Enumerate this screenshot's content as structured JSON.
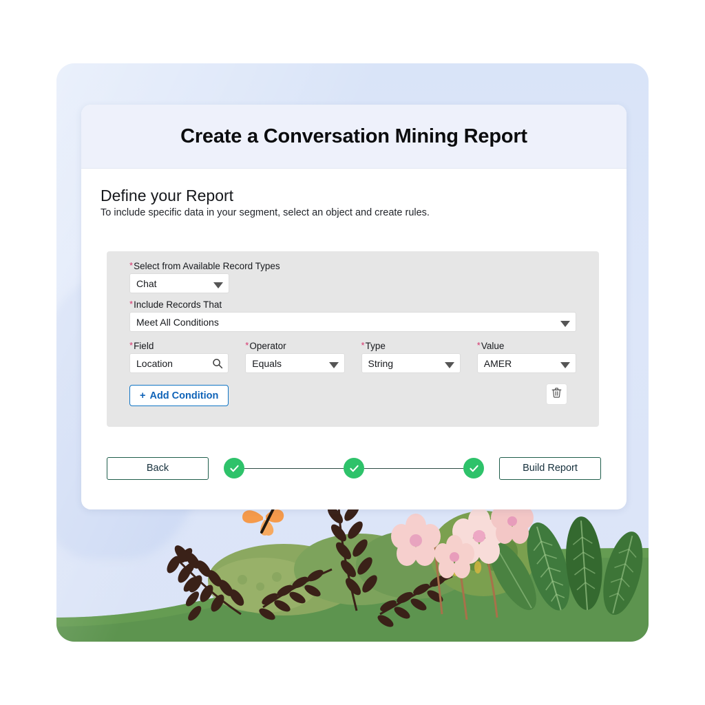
{
  "window": {
    "card_title": "Create a Conversation Mining Report",
    "section_heading": "Define your Report",
    "section_subtitle": "To include specific data in your segment, select an object and create rules."
  },
  "form": {
    "required_marker": "*",
    "record_types": {
      "label": "Select from Available Record Types",
      "value": "Chat",
      "icon": "chevron-down-icon"
    },
    "include_records": {
      "label": "Include Records That",
      "value": "Meet All Conditions",
      "icon": "chevron-down-icon"
    },
    "conditions": [
      {
        "field": {
          "label": "Field",
          "value": "Location",
          "icon": "search-icon"
        },
        "operator": {
          "label": "Operator",
          "value": "Equals",
          "icon": "chevron-down-icon"
        },
        "type": {
          "label": "Type",
          "value": "String",
          "icon": "chevron-down-icon"
        },
        "value": {
          "label": "Value",
          "value": "AMER",
          "icon": "chevron-down-icon"
        }
      }
    ],
    "add_condition_label": "Add Condition",
    "add_condition_glyph": "+",
    "delete_icon": "trash-icon"
  },
  "footer": {
    "back_label": "Back",
    "build_label": "Build Report",
    "steps": [
      {
        "state": "complete",
        "icon": "check-icon"
      },
      {
        "state": "complete",
        "icon": "check-icon"
      },
      {
        "state": "complete",
        "icon": "check-icon"
      }
    ]
  },
  "colors": {
    "panel_background": "#dde6f9",
    "card_header": "#eef1fb",
    "form_panel": "#e6e6e6",
    "accent_blue": "#0f63b8",
    "required_red": "#d6336c",
    "step_green": "#2ec26a",
    "button_border_green": "#1d5c4a",
    "grass_green": "#5d944f"
  },
  "illustration": {
    "name": "garden-illustration",
    "elements": [
      "butterfly",
      "ferns",
      "flowers",
      "shrubs",
      "leaves",
      "grass-hill"
    ]
  }
}
